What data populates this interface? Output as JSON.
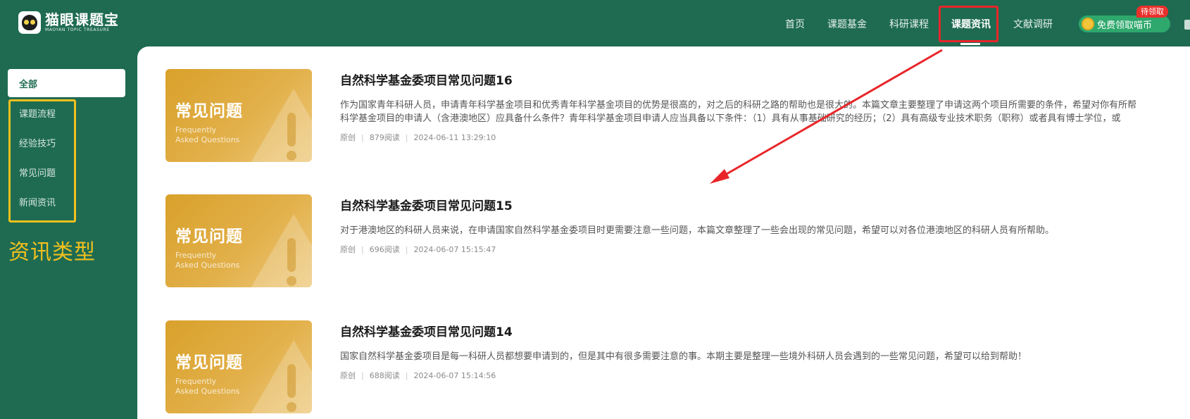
{
  "brand": {
    "name": "猫眼课题宝",
    "subtitle": "MAOYAN TOPIC TREASURE"
  },
  "nav": {
    "items": [
      "首页",
      "课题基金",
      "科研课程",
      "课题资讯",
      "文献调研"
    ],
    "active": "课题资讯",
    "coin_button": "免费领取喵币",
    "coin_badge": "待领取"
  },
  "sidebar": {
    "all_label": "全部",
    "items": [
      "课题流程",
      "经验技巧",
      "常见问题",
      "新闻资讯"
    ],
    "annotation": "资讯类型"
  },
  "thumbnail": {
    "title": "常见问题",
    "line1": "Frequently",
    "line2": "Asked Questions"
  },
  "articles": [
    {
      "title": "自然科学基金委项目常见问题16",
      "summary_1": "作为国家青年科研人员，申请青年科学基金项目和优秀青年科学基金项目的优势是很高的，对之后的科研之路的帮助也是很大的。本篇文章主要整理了申请这两个项目所需要的条件，希望对你有所帮",
      "summary_2": "科学基金项目的申请人（含港澳地区）应具备什么条件？青年科学基金项目申请人应当具备以下条件：（1）具有从事基础研究的经历；（2）具有高级专业技术职务（职称）或者具有博士学位，或",
      "tag": "原创",
      "reads": "879阅读",
      "date": "2024-06-11 13:29:10"
    },
    {
      "title": "自然科学基金委项目常见问题15",
      "summary_1": "对于港澳地区的科研人员来说，在申请国家自然科学基金委项目时更需要注意一些问题，本篇文章整理了一些会出现的常见问题，希望可以对各位港澳地区的科研人员有所帮助。",
      "summary_2": "",
      "tag": "原创",
      "reads": "696阅读",
      "date": "2024-06-07 15:15:47"
    },
    {
      "title": "自然科学基金委项目常见问题14",
      "summary_1": "国家自然科学基金委项目是每一科研人员都想要申请到的，但是其中有很多需要注意的事。本期主要是整理一些境外科研人员会遇到的一些常见问题，希望可以给到帮助！",
      "summary_2": "",
      "tag": "原创",
      "reads": "688阅读",
      "date": "2024-06-07 15:14:56"
    }
  ],
  "colors": {
    "sidebar_bg": "#1e6b52",
    "highlight_red": "#e8262a",
    "highlight_yellow": "#f2c01e",
    "thumb_gold": "#d9a12b"
  }
}
